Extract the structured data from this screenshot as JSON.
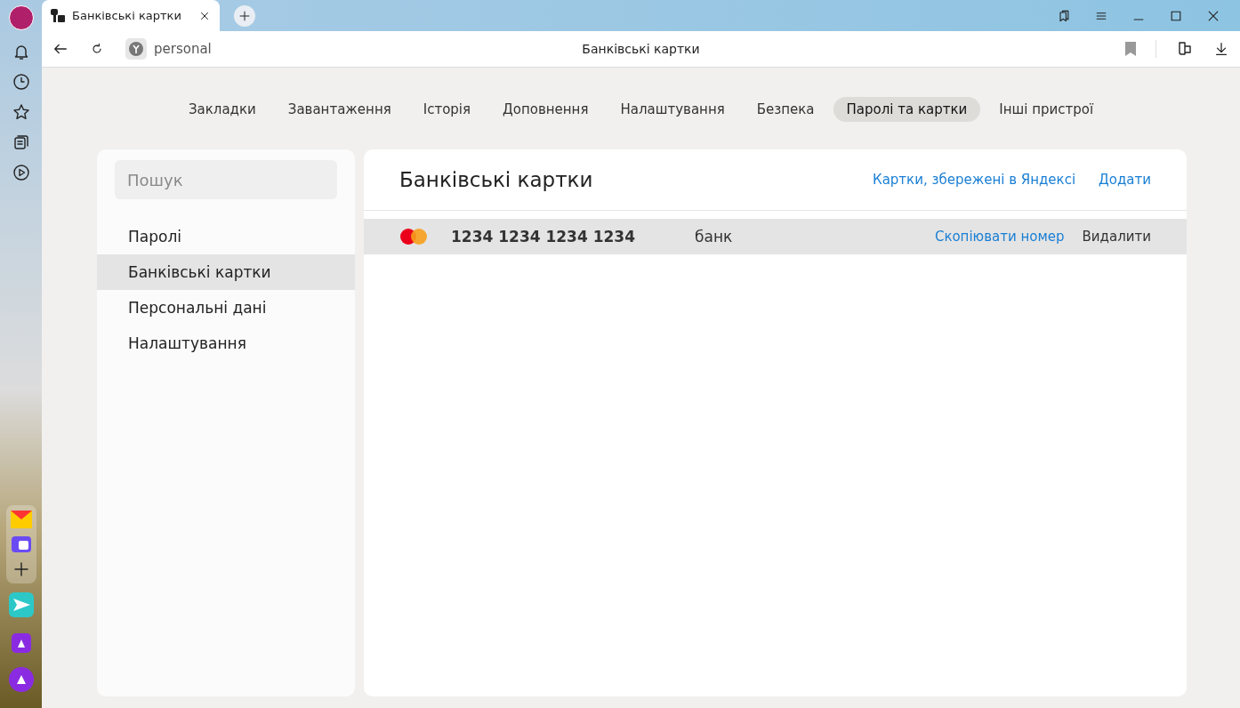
{
  "browser_tab": {
    "title": "Банківські картки"
  },
  "address_bar": {
    "url": "personal",
    "page_title": "Банківські картки"
  },
  "nav_tabs": [
    {
      "label": "Закладки",
      "selected": false
    },
    {
      "label": "Завантаження",
      "selected": false
    },
    {
      "label": "Історія",
      "selected": false
    },
    {
      "label": "Доповнення",
      "selected": false
    },
    {
      "label": "Налаштування",
      "selected": false
    },
    {
      "label": "Безпека",
      "selected": false
    },
    {
      "label": "Паролі та картки",
      "selected": true
    },
    {
      "label": "Інші пристрої",
      "selected": false
    }
  ],
  "search": {
    "placeholder": "Пошук"
  },
  "sidebar": {
    "items": [
      {
        "label": "Паролі",
        "selected": false
      },
      {
        "label": "Банківські картки",
        "selected": true
      },
      {
        "label": "Персональні дані",
        "selected": false
      },
      {
        "label": "Налаштування",
        "selected": false
      }
    ]
  },
  "panel": {
    "title": "Банківські картки",
    "links": [
      "Картки, збережені в Яндексі",
      "Додати"
    ]
  },
  "cards": [
    {
      "number": "1234 1234 1234 1234",
      "bank": "банк",
      "hovered": true,
      "actions": [
        {
          "label": "Скопіювати номер",
          "kind": "link"
        },
        {
          "label": "Видалити",
          "kind": "plain"
        }
      ]
    }
  ]
}
